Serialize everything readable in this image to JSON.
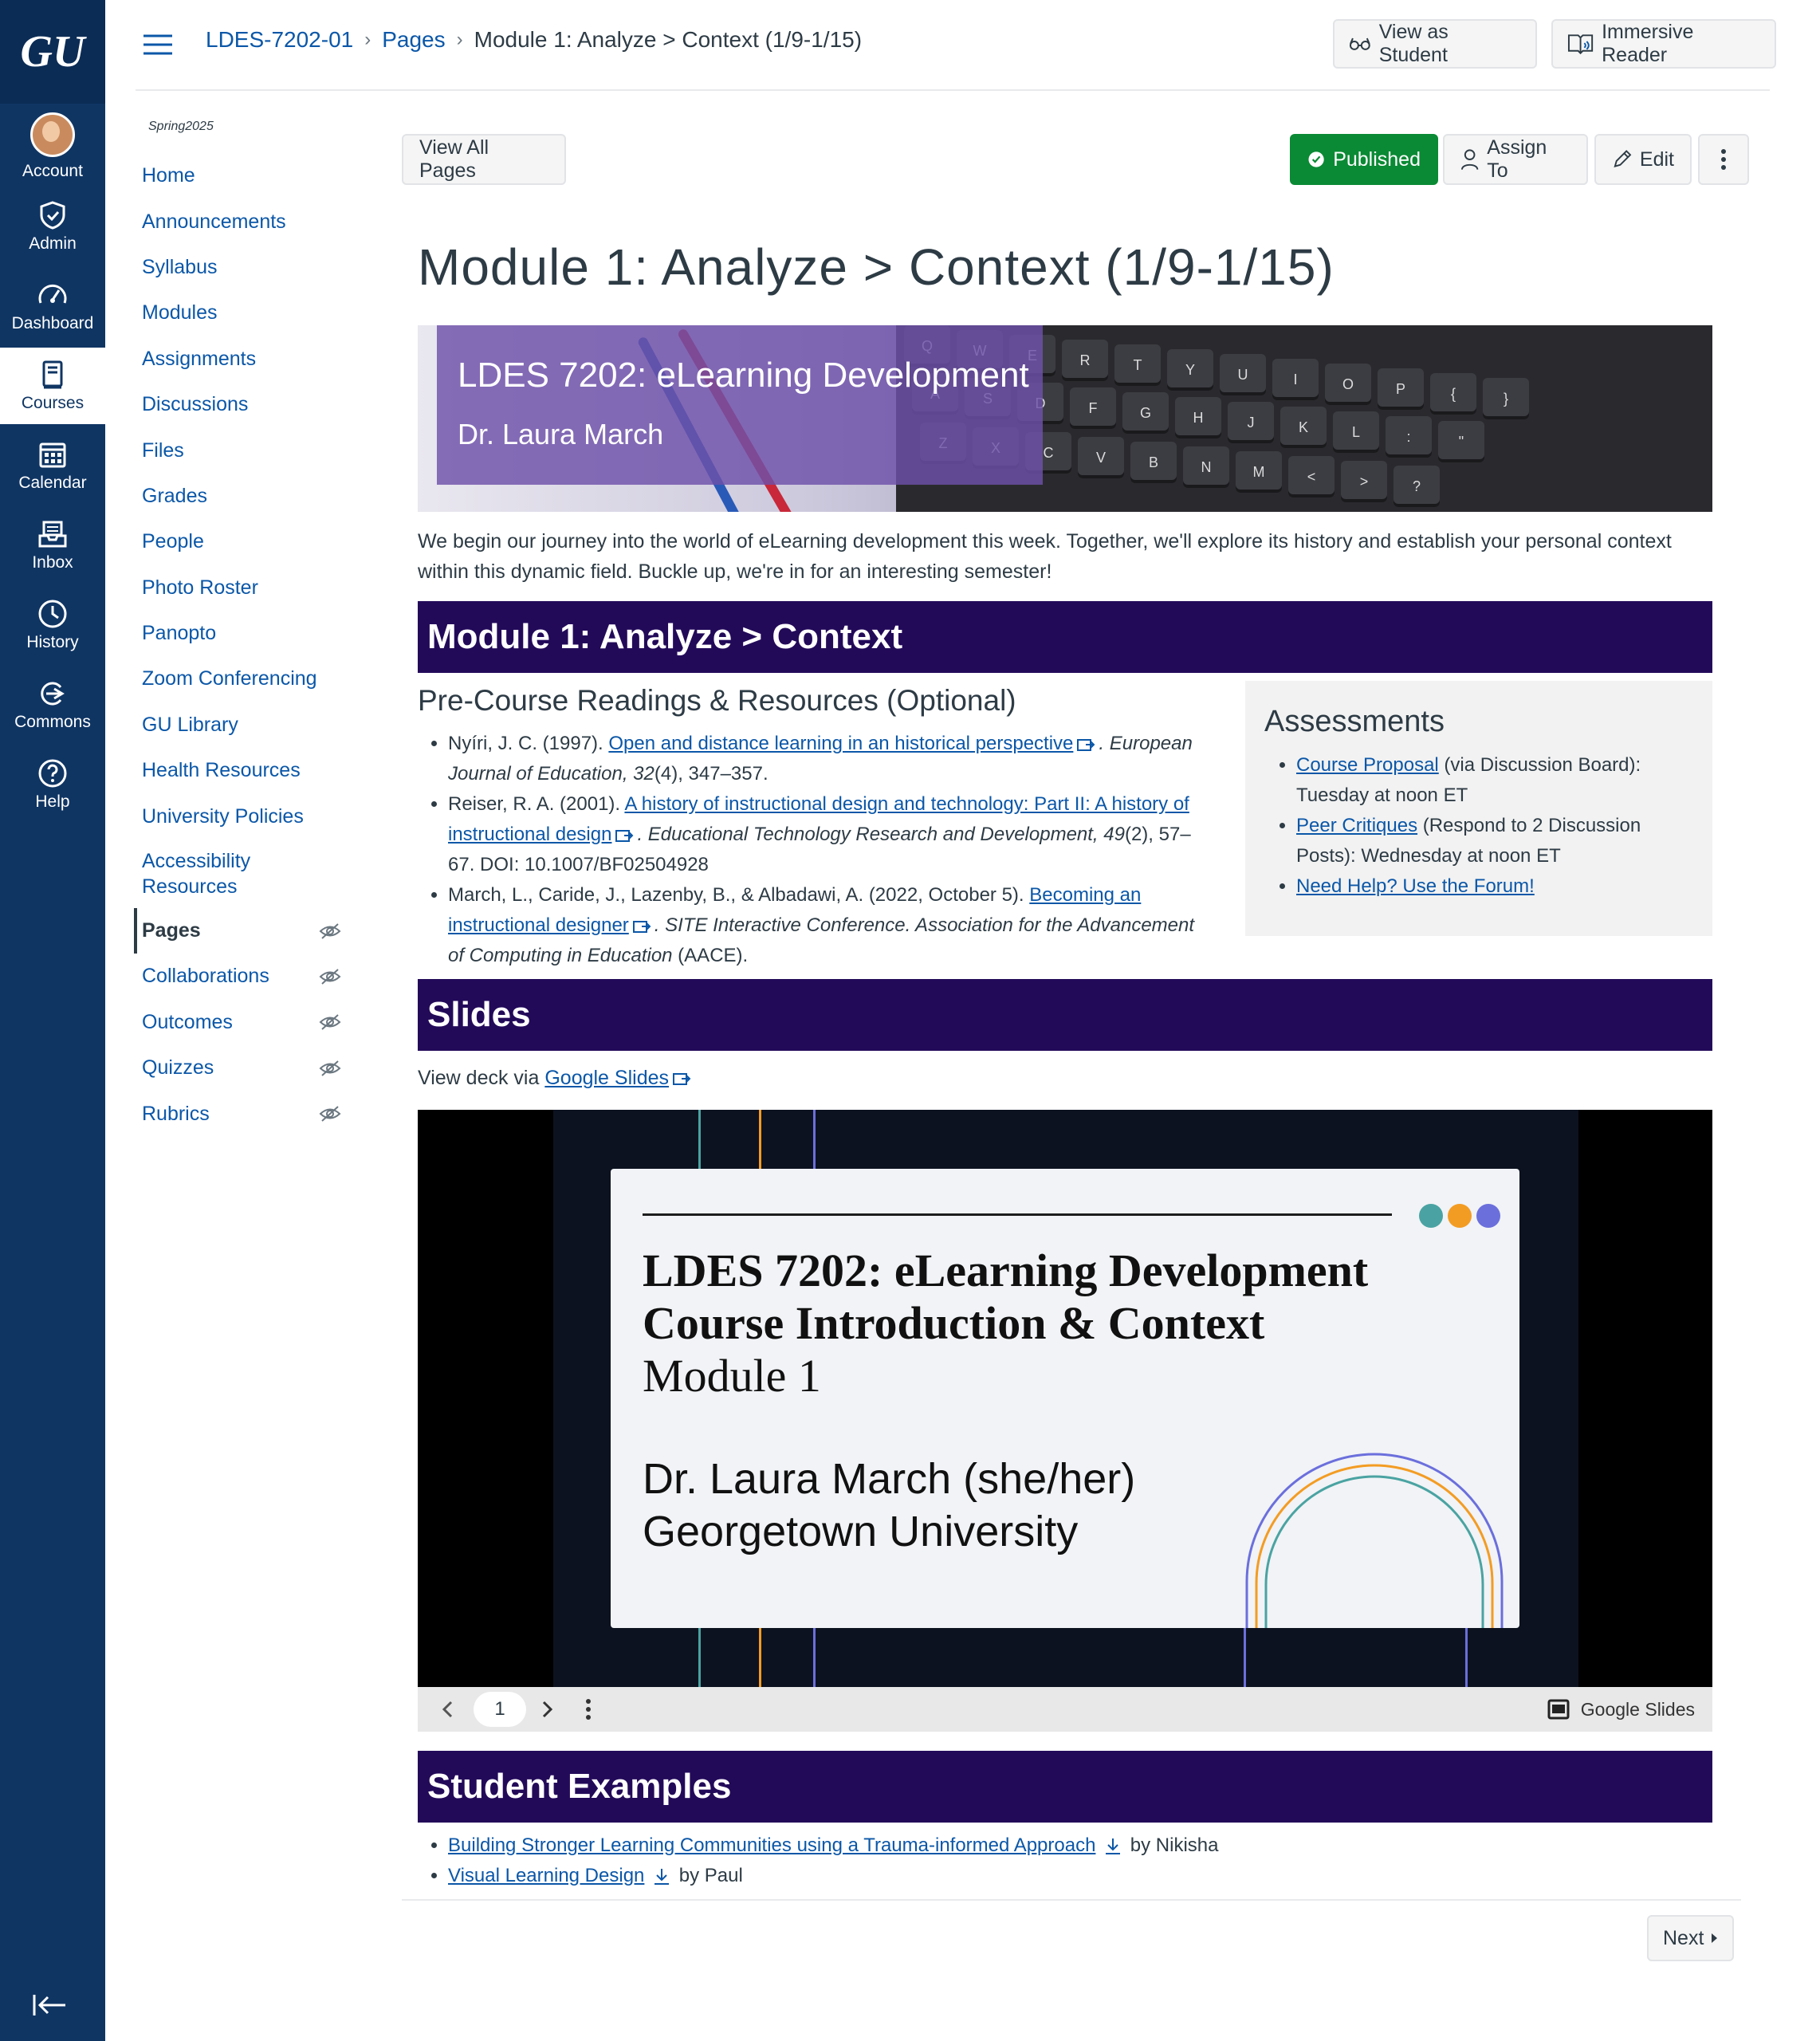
{
  "global_nav": {
    "logo": "GU",
    "items": [
      {
        "label": "Account",
        "icon": "avatar"
      },
      {
        "label": "Admin",
        "icon": "shield-icon"
      },
      {
        "label": "Dashboard",
        "icon": "speedometer-icon"
      },
      {
        "label": "Courses",
        "icon": "book-icon"
      },
      {
        "label": "Calendar",
        "icon": "calendar-icon"
      },
      {
        "label": "Inbox",
        "icon": "inbox-icon"
      },
      {
        "label": "History",
        "icon": "clock-icon"
      },
      {
        "label": "Commons",
        "icon": "commons-icon"
      },
      {
        "label": "Help",
        "icon": "question-icon"
      }
    ]
  },
  "breadcrumbs": {
    "course": "LDES-7202-01",
    "section": "Pages",
    "current": "Module 1: Analyze > Context (1/9-1/15)"
  },
  "header": {
    "view_as_student": "View as Student",
    "immersive_reader": "Immersive Reader"
  },
  "course_nav": {
    "term": "Spring2025",
    "items": [
      {
        "label": "Home"
      },
      {
        "label": "Announcements"
      },
      {
        "label": "Syllabus"
      },
      {
        "label": "Modules"
      },
      {
        "label": "Assignments"
      },
      {
        "label": "Discussions"
      },
      {
        "label": "Files"
      },
      {
        "label": "Grades"
      },
      {
        "label": "People"
      },
      {
        "label": "Photo Roster"
      },
      {
        "label": "Panopto"
      },
      {
        "label": "Zoom Conferencing"
      },
      {
        "label": "GU Library"
      },
      {
        "label": "Health Resources"
      },
      {
        "label": "University Policies"
      },
      {
        "label": "Accessibility Resources"
      },
      {
        "label": "Pages"
      },
      {
        "label": "Collaborations"
      },
      {
        "label": "Outcomes"
      },
      {
        "label": "Quizzes"
      },
      {
        "label": "Rubrics"
      }
    ]
  },
  "toolbar": {
    "view_all": "View All Pages",
    "published": "Published",
    "assign_to": "Assign To",
    "edit": "Edit"
  },
  "page": {
    "title": "Module 1: Analyze > Context (1/9-1/15)",
    "banner_title": "LDES 7202: eLearning Development",
    "banner_subtitle": "Dr. Laura March",
    "intro": "We begin our journey into the world of eLearning development this week. Together, we'll explore its history and establish your personal context within this dynamic field. Buckle up, we're in for an interesting semester!",
    "section_context": "Module 1: Analyze > Context",
    "readings_heading": "Pre-Course Readings & Resources (Optional)",
    "readings": [
      {
        "pre": "Nyíri, J. C. (1997). ",
        "link": "Open and distance learning in an historical perspective",
        "post_italic": ". European Journal of Education, ",
        "vol": "32",
        "post": "(4), 347–357."
      },
      {
        "pre": "Reiser, R. A. (2001). ",
        "link": "A history of instructional design and technology: Part II: A history of instructional design",
        "post_italic": ". Educational Technology Research and Development, ",
        "vol": "49",
        "post": "(2), 57–67. DOI: 10.1007/BF02504928"
      },
      {
        "pre": "March, L., Caride, J., Lazenby, B., & Albadawi, A. (2022, October 5). ",
        "link": "Becoming an instructional designer",
        "post_italic": ". SITE Interactive Conference. Association for the Advancement of Computing in Education",
        "vol": "",
        "post": " (AACE)."
      }
    ],
    "assessments_heading": "Assessments",
    "assessments": [
      {
        "link": "Course Proposal",
        "text": " (via Discussion Board): Tuesday at noon ET"
      },
      {
        "link": "Peer Critiques",
        "text": " (Respond to 2 Discussion Posts): Wednesday at noon ET"
      },
      {
        "link": "Need Help? Use the Forum!",
        "text": ""
      }
    ],
    "section_slides": "Slides",
    "view_deck_pre": "View deck via ",
    "view_deck_link": "Google Slides",
    "slide": {
      "line1": "LDES 7202: eLearning Development",
      "line2": "Course Introduction & Context",
      "line3": "Module 1",
      "line4": "Dr. Laura March (she/her)",
      "line5": "Georgetown University",
      "page": "1",
      "brand": "Google Slides"
    },
    "section_examples": "Student Examples",
    "examples": [
      {
        "link": "Building Stronger Learning Communities using a Trauma-informed Approach",
        "by": "by Nikisha"
      },
      {
        "link": "Visual Learning Design",
        "by": "by Paul"
      }
    ],
    "next": "Next"
  },
  "colors": {
    "nav_bg": "#0f3563",
    "link": "#0b57a8",
    "section_bar": "#230a59",
    "published": "#0a8a34",
    "dot_teal": "#4aa3a2",
    "dot_orange": "#f39c23",
    "dot_purple": "#6b6fdc"
  }
}
